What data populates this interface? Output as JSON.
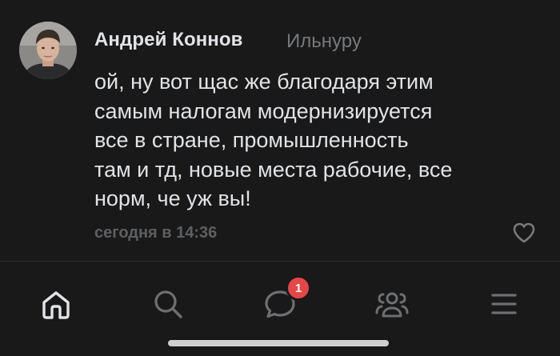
{
  "comment": {
    "author": "Андрей Коннов",
    "reply_to": "Ильнуру",
    "text_lines": [
      "ой, ну вот щас же благодаря этим",
      "самым налогам модернизируется",
      "все в стране, промышленность",
      "там и тд, новые места рабочие, все",
      "норм, че уж вы!"
    ],
    "timestamp": "сегодня в 14:36",
    "avatar_icon": "user-photo",
    "like_icon": "heart-outline-icon"
  },
  "tabbar": {
    "tabs": [
      {
        "name": "home",
        "icon": "home-icon",
        "active": true
      },
      {
        "name": "search",
        "icon": "search-icon",
        "active": false
      },
      {
        "name": "messages",
        "icon": "message-bubble-icon",
        "active": false,
        "badge": "1"
      },
      {
        "name": "friends",
        "icon": "people-icon",
        "active": false
      },
      {
        "name": "menu",
        "icon": "menu-icon",
        "active": false
      }
    ]
  },
  "colors": {
    "background": "#19191a",
    "primary_text": "#e1e3e6",
    "secondary_text": "#76787a",
    "icon_inactive": "#6d6f71",
    "icon_active": "#e1e3e6",
    "badge": "#e64646"
  }
}
